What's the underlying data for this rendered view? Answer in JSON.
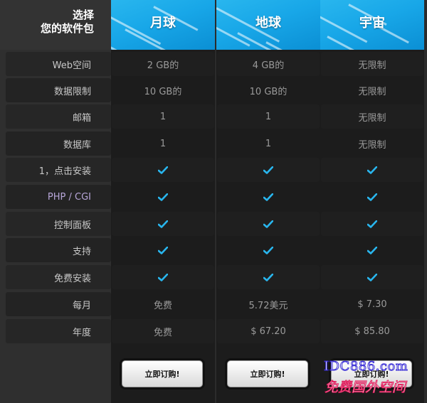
{
  "title": {
    "line1": "选择",
    "line2": "您的软件包"
  },
  "plans": [
    {
      "name": "月球",
      "cells": [
        "2 GB的",
        "10 GB的",
        "1",
        "1",
        "✓",
        "✓",
        "✓",
        "✓",
        "✓",
        "免费",
        "免费"
      ],
      "button": "立即订购!"
    },
    {
      "name": "地球",
      "cells": [
        "4 GB的",
        "10 GB的",
        "1",
        "1",
        "✓",
        "✓",
        "✓",
        "✓",
        "✓",
        "5.72美元",
        "$ 67.20"
      ],
      "button": "立即订购!"
    },
    {
      "name": "宇宙",
      "cells": [
        "无限制",
        "无限制",
        "无限制",
        "无限制",
        "✓",
        "✓",
        "✓",
        "✓",
        "✓",
        "$ 7.30",
        "$ 85.80"
      ],
      "button": "立即订购!"
    }
  ],
  "features": [
    "Web空间",
    "数据限制",
    "邮箱",
    "数据库",
    "1，点击安装",
    "PHP / CGI",
    "控制面板",
    "支持",
    "免费安装",
    "每月",
    "年度"
  ],
  "watermark": {
    "line1": "IDC886.com",
    "line2": "免费国外空间"
  },
  "colors": {
    "header_blue": "#18a7e8",
    "check_blue": "#29b6ee"
  }
}
